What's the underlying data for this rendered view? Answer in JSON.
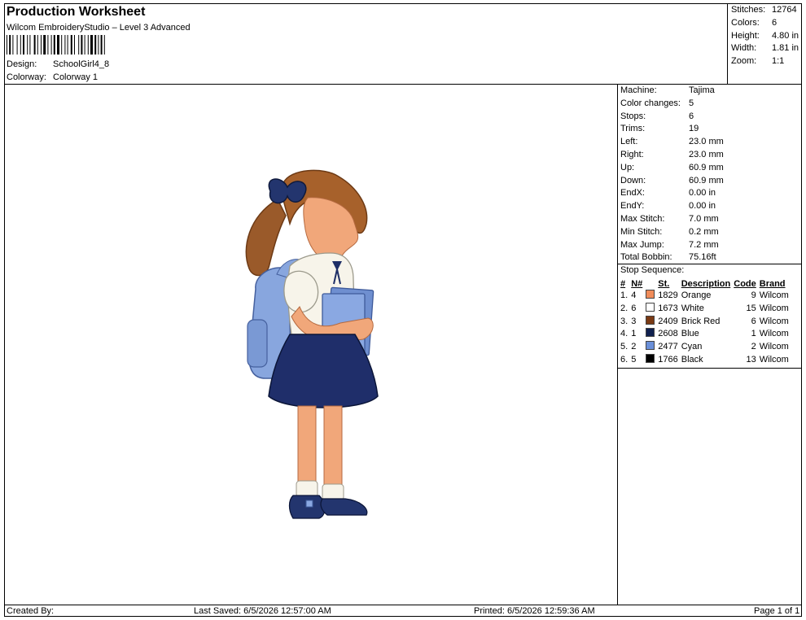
{
  "header": {
    "title": "Production Worksheet",
    "subtitle": "Wilcom EmbroideryStudio – Level 3 Advanced",
    "design_label": "Design:",
    "design_value": "SchoolGirl4_8",
    "colorway_label": "Colorway:",
    "colorway_value": "Colorway 1"
  },
  "summary": [
    {
      "label": "Stitches:",
      "value": "12764"
    },
    {
      "label": "Colors:",
      "value": "6"
    },
    {
      "label": "Height:",
      "value": "4.80 in"
    },
    {
      "label": "Width:",
      "value": "1.81 in"
    },
    {
      "label": "Zoom:",
      "value": "1:1"
    }
  ],
  "machine_info": [
    {
      "label": "Machine:",
      "value": "Tajima"
    },
    {
      "label": "Color changes:",
      "value": "5"
    },
    {
      "label": "Stops:",
      "value": "6"
    },
    {
      "label": "Trims:",
      "value": "19"
    },
    {
      "label": "Left:",
      "value": "23.0 mm"
    },
    {
      "label": "Right:",
      "value": "23.0 mm"
    },
    {
      "label": "Up:",
      "value": "60.9 mm"
    },
    {
      "label": "Down:",
      "value": "60.9 mm"
    },
    {
      "label": "EndX:",
      "value": "0.00 in"
    },
    {
      "label": "EndY:",
      "value": "0.00 in"
    },
    {
      "label": "Max Stitch:",
      "value": "7.0 mm"
    },
    {
      "label": "Min Stitch:",
      "value": "0.2 mm"
    },
    {
      "label": "Max Jump:",
      "value": "7.2 mm"
    },
    {
      "label": "Total Bobbin:",
      "value": "75.16ft"
    }
  ],
  "stop_sequence": {
    "title": "Stop Sequence:",
    "headers": [
      "#",
      "N#",
      "St.",
      "Description",
      "Code",
      "Brand"
    ],
    "rows": [
      {
        "idx": "1.",
        "n": "4",
        "color": "#f08c5a",
        "st": "1829",
        "desc": "Orange",
        "code": "9",
        "brand": "Wilcom"
      },
      {
        "idx": "2.",
        "n": "6",
        "color": "#ffffff",
        "st": "1673",
        "desc": "White",
        "code": "15",
        "brand": "Wilcom"
      },
      {
        "idx": "3.",
        "n": "3",
        "color": "#7a3a14",
        "st": "2409",
        "desc": "Brick Red",
        "code": "6",
        "brand": "Wilcom"
      },
      {
        "idx": "4.",
        "n": "1",
        "color": "#10214f",
        "st": "2608",
        "desc": "Blue",
        "code": "1",
        "brand": "Wilcom"
      },
      {
        "idx": "5.",
        "n": "2",
        "color": "#6a8fd8",
        "st": "2477",
        "desc": "Cyan",
        "code": "2",
        "brand": "Wilcom"
      },
      {
        "idx": "6.",
        "n": "5",
        "color": "#000000",
        "st": "1766",
        "desc": "Black",
        "code": "13",
        "brand": "Wilcom"
      }
    ]
  },
  "footer": {
    "created_by": "Created By:",
    "last_saved": "Last Saved: 6/5/2026 12:57:00 AM",
    "printed": "Printed: 6/5/2026 12:59:36 AM",
    "page": "Page 1 of 1"
  }
}
